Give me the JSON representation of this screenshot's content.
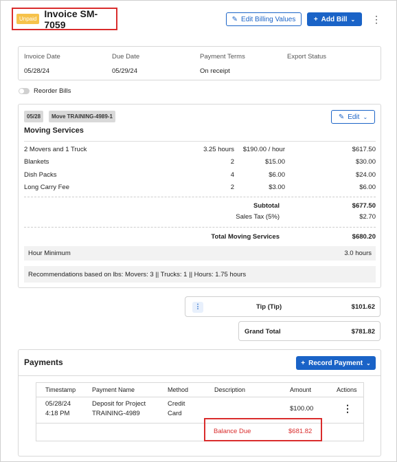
{
  "header": {
    "status_badge": "Unpaid",
    "title": "Invoice SM-7059",
    "edit_billing_label": "Edit Billing Values",
    "add_bill_label": "Add Bill"
  },
  "info": {
    "invoice_date_label": "Invoice Date",
    "invoice_date": "05/28/24",
    "due_date_label": "Due Date",
    "due_date": "05/29/24",
    "payment_terms_label": "Payment Terms",
    "payment_terms": "On receipt",
    "export_status_label": "Export Status",
    "export_status": ""
  },
  "reorder_label": "Reorder Bills",
  "bill": {
    "date_tag": "05/28",
    "move_tag": "Move TRAINING-4989-1",
    "edit_label": "Edit",
    "title": "Moving Services",
    "lines": [
      {
        "name": "2 Movers and 1 Truck",
        "qty": "3.25 hours",
        "rate": "$190.00 / hour",
        "amount": "$617.50"
      },
      {
        "name": "Blankets",
        "qty": "2",
        "rate": "$15.00",
        "amount": "$30.00"
      },
      {
        "name": "Dish Packs",
        "qty": "4",
        "rate": "$6.00",
        "amount": "$24.00"
      },
      {
        "name": "Long Carry Fee",
        "qty": "2",
        "rate": "$3.00",
        "amount": "$6.00"
      }
    ],
    "subtotal_label": "Subtotal",
    "subtotal": "$677.50",
    "tax_label": "Sales Tax (5%)",
    "tax": "$2.70",
    "total_label": "Total Moving Services",
    "total": "$680.20",
    "hour_min_label": "Hour Minimum",
    "hour_min": "3.0 hours",
    "recommendation": "Recommendations based on lbs:  Movers: 3 || Trucks: 1 || Hours: 1.75 hours"
  },
  "tip": {
    "label": "Tip (Tip)",
    "amount": "$101.62"
  },
  "grand_total": {
    "label": "Grand Total",
    "amount": "$781.82"
  },
  "payments": {
    "title": "Payments",
    "record_label": "Record Payment",
    "columns": [
      "Timestamp",
      "Payment Name",
      "Method",
      "Description",
      "Amount",
      "Actions"
    ],
    "rows": [
      {
        "timestamp_date": "05/28/24",
        "timestamp_time": "4:18 PM",
        "name_line1": "Deposit for Project",
        "name_line2": "TRAINING-4989",
        "method_line1": "Credit",
        "method_line2": "Card",
        "description": "",
        "amount": "$100.00"
      }
    ],
    "balance_label": "Balance Due",
    "balance": "$681.82"
  },
  "colors": {
    "accent": "#1a63c7",
    "unpaid": "#f6c24b",
    "highlight": "#d92b2b"
  }
}
